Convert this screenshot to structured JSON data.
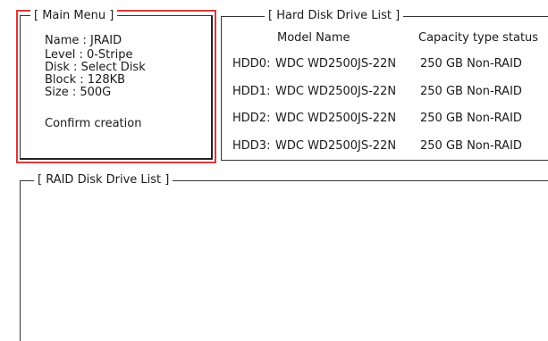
{
  "main_menu": {
    "title": "[ Main Menu ]",
    "items": [
      {
        "label": "Name : JRAID"
      },
      {
        "label": "Level : 0-Stripe"
      },
      {
        "label": "Disk : Select Disk"
      },
      {
        "label": "Block : 128KB"
      },
      {
        "label": "Size : 500G"
      },
      {
        "label": "Confirm creation"
      }
    ]
  },
  "hdd_list": {
    "title": "[ Hard Disk Drive List ]",
    "headers": [
      "Model Name",
      "Capacity type status"
    ],
    "rows": [
      {
        "id": "HDD0:",
        "model": "WDC WD2500JS-22N",
        "status": "250 GB Non-RAID"
      },
      {
        "id": "HDD1:",
        "model": "WDC WD2500JS-22N",
        "status": "250 GB Non-RAID"
      },
      {
        "id": "HDD2:",
        "model": "WDC WD2500JS-22N",
        "status": "250 GB Non-RAID"
      },
      {
        "id": "HDD3:",
        "model": "WDC WD2500JS-22N",
        "status": "250 GB Non-RAID"
      }
    ]
  },
  "raid_list": {
    "title": "[ RAID Disk Drive List ]"
  },
  "colors": {
    "highlight_border": "#d63a3a",
    "text": "#1a1a1a",
    "background": "#ffffff"
  }
}
